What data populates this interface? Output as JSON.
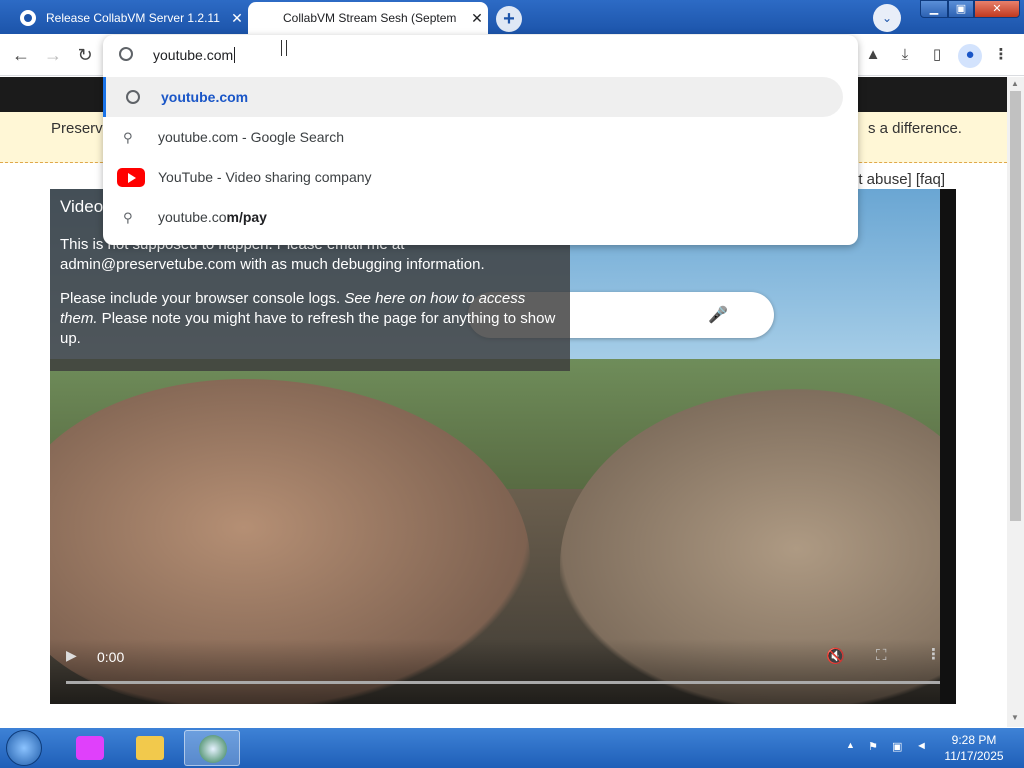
{
  "tabs": [
    {
      "title": "Release CollabVM Server 1.2.11",
      "close": "✕"
    },
    {
      "title": "CollabVM Stream Sesh (Septem",
      "close": "✕"
    }
  ],
  "window": {
    "new_tab": "+",
    "tab_search": "⌄",
    "minimize": "▁",
    "maximize": "▣",
    "close": "✕"
  },
  "toolbar": {
    "back": "←",
    "forward": "→",
    "reload": "↻",
    "extension": "▲",
    "download": "⤓",
    "side_panel": "▯",
    "profile": "●",
    "menu": "⋮"
  },
  "omnibox": {
    "value": "youtube.com",
    "suggestions": [
      {
        "icon": "globe-icon",
        "text": "youtube.com"
      },
      {
        "icon": "search-icon",
        "text": "youtube.com - Google Search"
      },
      {
        "icon": "youtube-icon",
        "text": "YouTube - Video sharing company"
      },
      {
        "icon": "search-icon",
        "text_prefix": "youtube.co",
        "text_bold": "m/pay"
      }
    ]
  },
  "page": {
    "banner_left": "Preserv",
    "banner_right": "s a difference.",
    "links": "ort abuse] [faq]",
    "error": {
      "title": "Video",
      "line1": "This is not supposed to happen. Please email me at admin@preservetube.com with as much debugging information.",
      "line2_prefix": "Please include your browser console logs. ",
      "line2_italic": "See here on how to access them.",
      "line2_suffix": " Please note you might have to refresh the page for anything to show up."
    },
    "player": {
      "time": "0:00",
      "play": "▶",
      "mute": "🔇",
      "fullscreen": "⛶",
      "more": "⋮",
      "progress": 0
    }
  },
  "taskbar": {
    "clock_time": "9:28 PM",
    "clock_date": "11/17/2025",
    "tray_up": "▲"
  },
  "icons": {
    "search": "⚲",
    "mic": "🎤"
  }
}
